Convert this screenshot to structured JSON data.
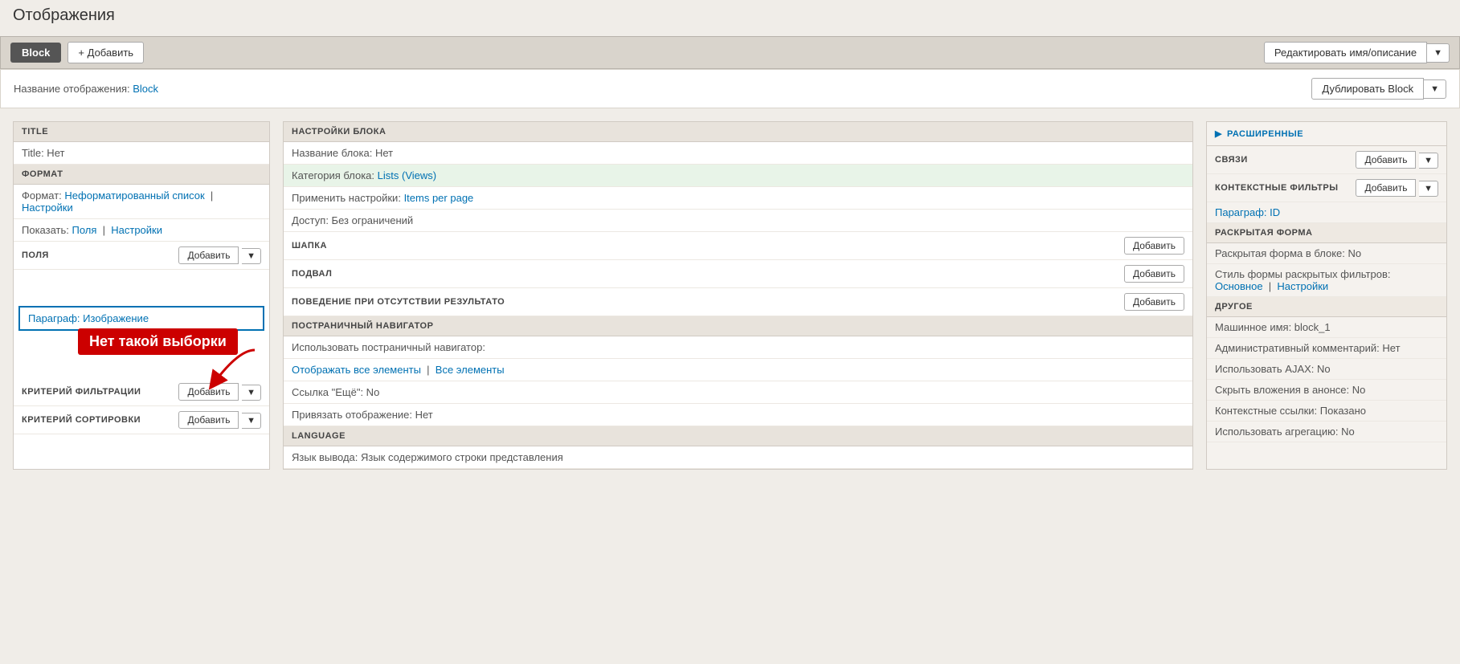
{
  "page": {
    "title": "Отображения"
  },
  "toolbar": {
    "block_label": "Block",
    "add_label": "Добавить",
    "edit_name_label": "Редактировать имя/описание",
    "dropdown_char": "▼"
  },
  "view_name_bar": {
    "prefix": "Название отображения:",
    "name": "Block",
    "duplicate_label": "Дублировать Block",
    "dropdown_char": "▼"
  },
  "left_col": {
    "title_section": {
      "header": "TITLE",
      "row": "Title: Нет"
    },
    "format_section": {
      "header": "ФОРМАТ",
      "format_row": "Формат:",
      "format_link": "Неформатированный список",
      "settings_link": "Настройки",
      "show_row": "Показать:",
      "show_link": "Поля",
      "show_settings_link": "Настройки"
    },
    "fields_section": {
      "header": "ПОЛЯ",
      "add_label": "Добавить",
      "dropdown_char": "▼",
      "field_item": "Параграф: Изображение"
    },
    "filter_section": {
      "header": "КРИТЕРИЙ ФИЛЬТРАЦИИ",
      "add_label": "Добавить",
      "dropdown_char": "▼"
    },
    "sort_section": {
      "header": "КРИТЕРИЙ СОРТИРОВКИ",
      "add_label": "Добавить",
      "dropdown_char": "▼"
    },
    "error_text": "Нет такой выборки"
  },
  "middle_col": {
    "block_settings": {
      "header": "НАСТРОЙКИ БЛОКА",
      "name_row": "Название блока: Нет",
      "category_row_label": "Категория блока:",
      "category_link": "Lists (Views)",
      "apply_row_label": "Применить настройки:",
      "apply_link": "Items per page",
      "access_row": "Доступ: Без ограничений"
    },
    "header_section": {
      "header": "ШАПКА",
      "add_label": "Добавить"
    },
    "footer_section": {
      "header": "ПОДВАЛ",
      "add_label": "Добавить"
    },
    "empty_section": {
      "header": "ПОВЕДЕНИЕ ПРИ ОТСУТСТВИИ РЕЗУЛЬТАТО",
      "add_label": "Добавить"
    },
    "pager_section": {
      "header": "ПОСТРАНИЧНЫЙ НАВИГАТОР",
      "use_row": "Использовать постраничный навигатор:",
      "display_link": "Отображать все элементы",
      "all_link": "Все элементы",
      "more_row": "Ссылка \"Ещё\": No",
      "attach_row": "Привязать отображение: Нет"
    },
    "language_section": {
      "header": "LANGUAGE",
      "lang_row": "Язык вывода: Язык содержимого строки представления"
    }
  },
  "right_col": {
    "expanded_header": "РАСШИРЕННЫЕ",
    "relations": {
      "label": "СВЯЗИ",
      "add_label": "Добавить",
      "dropdown_char": "▼"
    },
    "context_filters": {
      "label": "КОНТЕКСТНЫЕ ФИЛЬТРЫ",
      "add_label": "Добавить",
      "dropdown_char": "▼",
      "item": "Параграф: ID"
    },
    "exposed_form": {
      "header": "РАСКРЫТАЯ ФОРМА",
      "in_block_row": "Раскрытая форма в блоке: No",
      "style_row_label": "Стиль формы раскрытых фильтров:",
      "style_link": "Основное",
      "settings_link": "Настройки"
    },
    "other": {
      "header": "ДРУГОЕ",
      "machine_name_row": "Машинное имя: block_1",
      "admin_comment_row": "Административный комментарий: Нет",
      "ajax_row": "Использовать AJAX: No",
      "hide_attachments_row": "Скрыть вложения в анонсе: No",
      "contextual_links_row": "Контекстные ссылки: Показано",
      "aggregation_row": "Использовать агрегацию: No"
    }
  }
}
